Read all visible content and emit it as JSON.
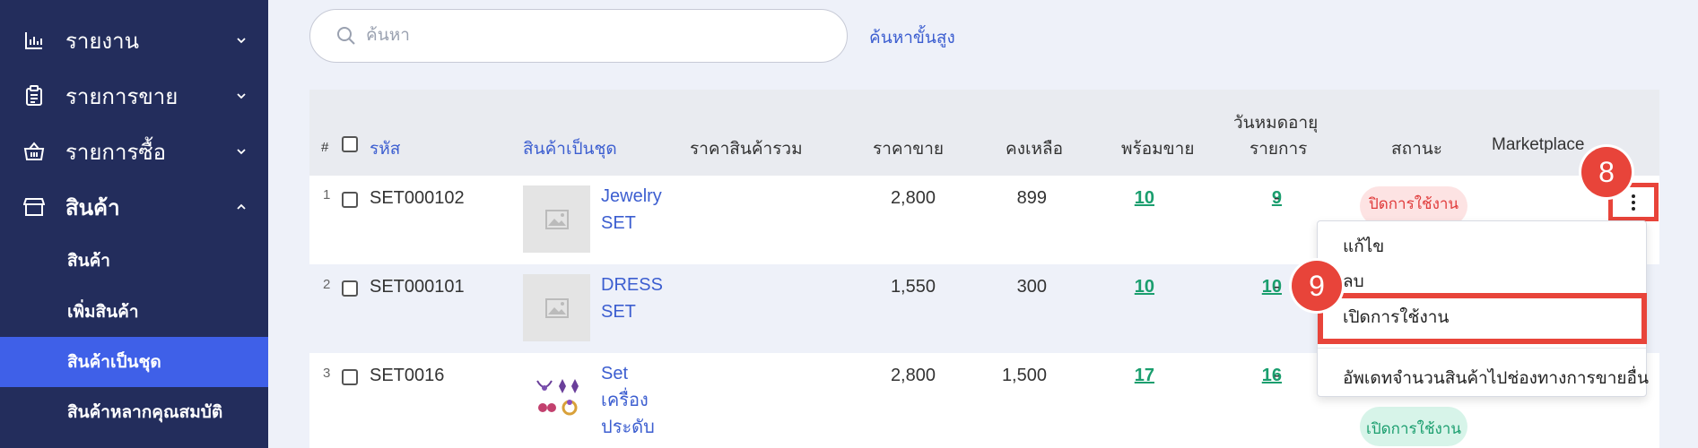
{
  "sidebar": {
    "items": [
      {
        "label": "รายงาน",
        "icon": "bar-chart-icon",
        "expanded": false
      },
      {
        "label": "รายการขาย",
        "icon": "clipboard-icon",
        "expanded": false
      },
      {
        "label": "รายการซื้อ",
        "icon": "basket-icon",
        "expanded": false
      },
      {
        "label": "สินค้า",
        "icon": "store-icon",
        "expanded": true
      }
    ],
    "subitems": [
      {
        "label": "สินค้า",
        "active": false
      },
      {
        "label": "เพิ่มสินค้า",
        "active": false
      },
      {
        "label": "สินค้าเป็นชุด",
        "active": true
      },
      {
        "label": "สินค้าหลากคุณสมบัติ",
        "active": false
      }
    ]
  },
  "search": {
    "placeholder": "ค้นหา",
    "value": "",
    "advanced_label": "ค้นหาขั้นสูง"
  },
  "table": {
    "headers": {
      "index": "#",
      "code": "รหัส",
      "set": "สินค้าเป็นชุด",
      "total_price": "ราคาสินค้ารวม",
      "sale_price": "ราคาขาย",
      "remaining": "คงเหลือ",
      "ready": "พร้อมขาย",
      "expiry_line1": "วันหมดอายุ",
      "expiry_line2": "รายการ",
      "status": "สถานะ",
      "marketplace": "Marketplace"
    },
    "rows": [
      {
        "index": "1",
        "code": "SET000102",
        "name": "Jewelry SET",
        "total_price": "2,800",
        "sale_price": "899",
        "remaining": "10",
        "ready": "9",
        "expiry": "-",
        "status": "ปิดการใช้งาน",
        "status_color": "#e03b3b"
      },
      {
        "index": "2",
        "code": "SET000101",
        "name": "DRESS SET",
        "total_price": "1,550",
        "sale_price": "300",
        "remaining": "10",
        "ready": "10",
        "expiry": "-",
        "status": "",
        "status_color": ""
      },
      {
        "index": "3",
        "code": "SET0016",
        "name": "Set เครื่องประดับ",
        "total_price": "2,800",
        "sale_price": "1,500",
        "remaining": "17",
        "ready": "16",
        "expiry": "-",
        "status": "เปิดการใช้งาน",
        "status_color": "#1a9e6e"
      }
    ]
  },
  "action_menu": {
    "items": [
      "แก้ไข",
      "ลบ",
      "เปิดการใช้งาน",
      "อัพเดทจำนวนสินค้าไปช่องทางการขายอื่น"
    ]
  },
  "markers": [
    "8",
    "9"
  ],
  "colors": {
    "sidebar_bg": "#232d5c",
    "active_bg": "#3f60e8",
    "accent": "#3c5ed0",
    "green": "#1a9e6e",
    "highlight": "#e8443a"
  }
}
